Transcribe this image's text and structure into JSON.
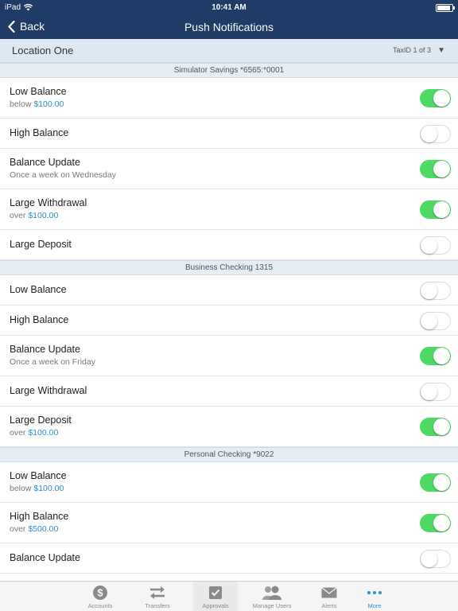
{
  "status_bar": {
    "carrier": "iPad",
    "time": "10:41 AM"
  },
  "nav": {
    "back_label": "Back",
    "title": "Push Notifications"
  },
  "location": {
    "name": "Location One",
    "taxid": "TaxID 1 of 3"
  },
  "sections": [
    {
      "header": "Simulator Savings *6565:*0001",
      "rows": [
        {
          "label": "Low Balance",
          "sub_prefix": "below ",
          "sub_amount": "$100.00",
          "on": true
        },
        {
          "label": "High Balance",
          "on": false
        },
        {
          "label": "Balance Update",
          "sub_prefix": "Once a week on Wednesday",
          "on": true
        },
        {
          "label": "Large Withdrawal",
          "sub_prefix": "over ",
          "sub_amount": "$100.00",
          "on": true
        },
        {
          "label": "Large Deposit",
          "on": false
        }
      ]
    },
    {
      "header": "Business Checking 1315",
      "rows": [
        {
          "label": "Low Balance",
          "on": false
        },
        {
          "label": "High Balance",
          "on": false
        },
        {
          "label": "Balance Update",
          "sub_prefix": "Once a week on Friday",
          "on": true
        },
        {
          "label": "Large Withdrawal",
          "on": false
        },
        {
          "label": "Large Deposit",
          "sub_prefix": "over ",
          "sub_amount": "$100.00",
          "on": true
        }
      ]
    },
    {
      "header": "Personal Checking *9022",
      "rows": [
        {
          "label": "Low Balance",
          "sub_prefix": "below ",
          "sub_amount": "$100.00",
          "on": true
        },
        {
          "label": "High Balance",
          "sub_prefix": "over ",
          "sub_amount": "$500.00",
          "on": true
        },
        {
          "label": "Balance Update",
          "on": false
        }
      ]
    }
  ],
  "tabs": [
    {
      "label": "Accounts",
      "icon": "dollar-coin-icon",
      "active": false
    },
    {
      "label": "Transfers",
      "icon": "transfer-arrows-icon",
      "active": false
    },
    {
      "label": "Approvals",
      "icon": "checkbox-icon",
      "active": false
    },
    {
      "label": "Manage Users",
      "icon": "users-icon",
      "active": false
    },
    {
      "label": "Alerts",
      "icon": "envelope-icon",
      "active": false
    },
    {
      "label": "More",
      "icon": "more-dots-icon",
      "active": true
    }
  ],
  "colors": {
    "nav_background": "#1f3c66",
    "toggle_on": "#4cd964",
    "link_amount": "#2b8fd1",
    "section_header_bg": "#e6eef5",
    "location_bar_bg": "#dde9f2"
  }
}
